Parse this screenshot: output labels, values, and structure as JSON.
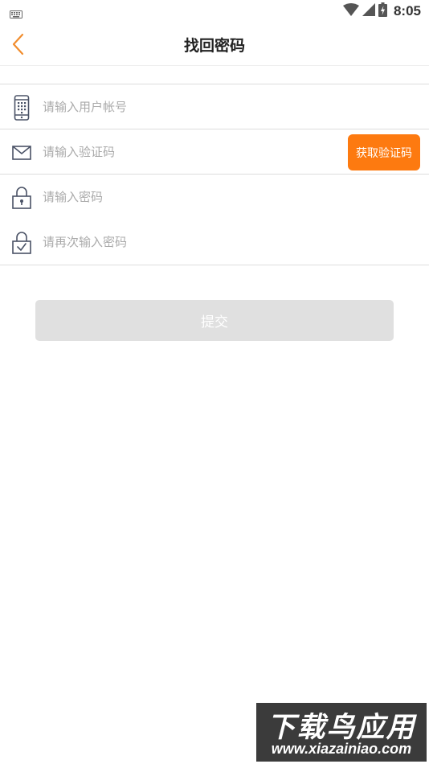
{
  "status_bar": {
    "time": "8:05",
    "icons": [
      "keyboard-icon",
      "wifi-icon",
      "cell-signal-icon",
      "battery-charging-icon"
    ]
  },
  "nav": {
    "title": "找回密码",
    "back_icon": "chevron-left-icon",
    "accent_color": "#f18d2e"
  },
  "form": {
    "account": {
      "placeholder": "请输入用户帐号",
      "value": "",
      "icon": "phone-icon"
    },
    "code": {
      "placeholder": "请输入验证码",
      "value": "",
      "icon": "mail-icon"
    },
    "get_code_label": "获取验证码",
    "password": {
      "placeholder": "请输入密码",
      "value": "",
      "icon": "lock-icon"
    },
    "confirm_password": {
      "placeholder": "请再次输入密码",
      "value": "",
      "icon": "lock-check-icon"
    }
  },
  "submit_label": "提交",
  "colors": {
    "primary": "#fd7a10",
    "submit_disabled": "#e0e0e0",
    "placeholder": "#aaaaaa",
    "icon": "#4a5266"
  },
  "watermark": {
    "title": "下载鸟应用",
    "url": "www.xiazainiao.com"
  }
}
